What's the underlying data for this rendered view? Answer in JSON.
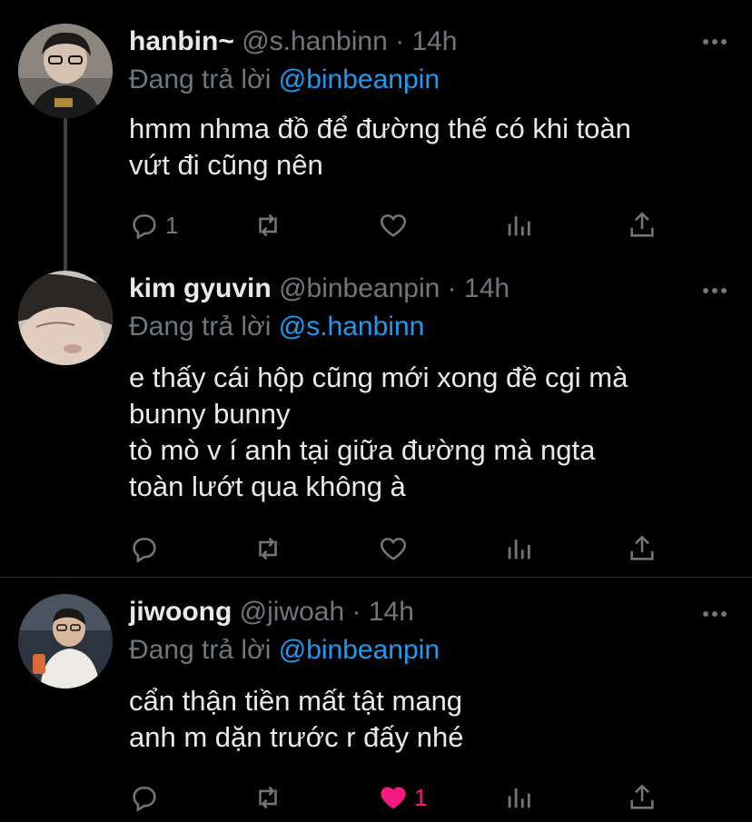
{
  "tweets": [
    {
      "name": "hanbin~",
      "handle": "@s.hanbinn",
      "sep": "·",
      "time": "14h",
      "reply_prefix": "Đang trả lời",
      "reply_to": "@binbeanpin",
      "lines": [
        "hmm nhma đồ để đường thế có khi toàn",
        "vứt đi cũng nên"
      ],
      "reply_count": "1",
      "like_count": "",
      "liked": false
    },
    {
      "name": "kim gyuvin",
      "handle": "@binbeanpin",
      "sep": "·",
      "time": "14h",
      "reply_prefix": "Đang trả lời",
      "reply_to": "@s.hanbinn",
      "lines": [
        "e thấy cái hộp cũng mới xong đề cgi mà",
        "bunny bunny",
        "tò mò v í anh tại giữa đường mà ngta",
        "toàn lướt qua không à"
      ],
      "reply_count": "",
      "like_count": "",
      "liked": false
    },
    {
      "name": "jiwoong",
      "handle": "@jiwoah",
      "sep": "·",
      "time": "14h",
      "reply_prefix": "Đang trả lời",
      "reply_to": "@binbeanpin",
      "lines": [
        "cẩn thận tiền mất tật mang",
        "anh m dặn trước r đấy nhé"
      ],
      "reply_count": "",
      "like_count": "1",
      "liked": true
    }
  ],
  "colors": {
    "background": "#000000",
    "text": "#e7e9ea",
    "muted": "#71767b",
    "link": "#1d9bf0",
    "like": "#f91880"
  }
}
